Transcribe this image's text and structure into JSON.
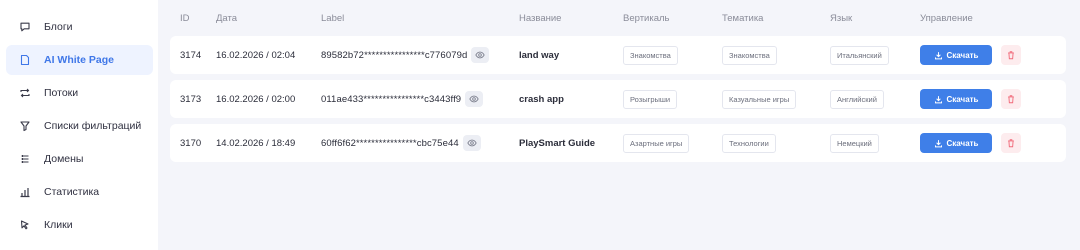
{
  "sidebar": {
    "items": [
      {
        "label": "Блоги",
        "icon": "chat-bubble-icon",
        "active": false
      },
      {
        "label": "AI White Page",
        "icon": "document-icon",
        "active": true
      },
      {
        "label": "Потоки",
        "icon": "repeat-icon",
        "active": false
      },
      {
        "label": "Списки фильтраций",
        "icon": "filter-icon",
        "active": false
      },
      {
        "label": "Домены",
        "icon": "server-icon",
        "active": false
      },
      {
        "label": "Статистика",
        "icon": "bar-chart-icon",
        "active": false
      },
      {
        "label": "Клики",
        "icon": "cursor-icon",
        "active": false
      }
    ]
  },
  "table": {
    "headers": {
      "id": "ID",
      "date": "Дата",
      "label": "Label",
      "name": "Название",
      "vertical": "Вертикаль",
      "theme": "Тематика",
      "language": "Язык",
      "actions": "Управление"
    },
    "rows": [
      {
        "id": "3174",
        "date": "16.02.2026 / 02:04",
        "label": "89582b72****************c776079d",
        "name": "land way",
        "vertical": "Знакомства",
        "theme": "Знакомства",
        "language": "Итальянский",
        "download": "Скачать"
      },
      {
        "id": "3173",
        "date": "16.02.2026 / 02:00",
        "label": "011ae433****************c3443ff9",
        "name": "crash app",
        "vertical": "Розыгрыши",
        "theme": "Казуальные игры",
        "language": "Английский",
        "download": "Скачать"
      },
      {
        "id": "3170",
        "date": "14.02.2026 / 18:49",
        "label": "60ff6f62****************cbc75e44",
        "name": "PlaySmart Guide",
        "vertical": "Азартные игры",
        "theme": "Технологии",
        "language": "Немецкий",
        "download": "Скачать"
      }
    ]
  },
  "colors": {
    "accent": "#3f7fe8",
    "active_bg": "#eef3ff",
    "danger": "#f16a7a",
    "danger_bg": "#fdecee",
    "page_bg": "#f4f5fa"
  }
}
